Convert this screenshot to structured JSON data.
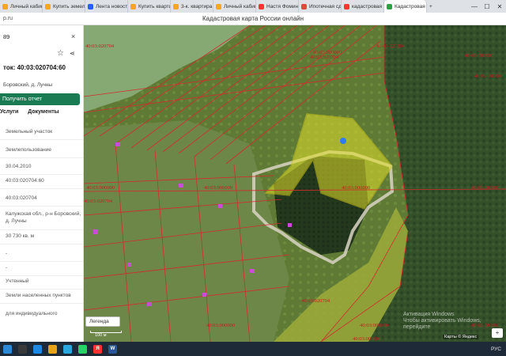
{
  "browser": {
    "tabs": [
      {
        "label": "Личный кабин",
        "color": "#f5a623"
      },
      {
        "label": "Купить земел",
        "color": "#f5a623"
      },
      {
        "label": "Лента новост",
        "color": "#2a5cff"
      },
      {
        "label": "Купить кварти",
        "color": "#f5a623"
      },
      {
        "label": "3-к. квартира,",
        "color": "#f5a623"
      },
      {
        "label": "Личный кабин",
        "color": "#f5a623"
      },
      {
        "label": "Настя Фомина",
        "color": "#ff3333"
      },
      {
        "label": "Ипотечная сд",
        "color": "#e0493a"
      },
      {
        "label": "кадастровая ка",
        "color": "#ff3333"
      },
      {
        "label": "Кадастровая",
        "color": "#2ea043"
      }
    ],
    "close_glyph": "×",
    "new_tab_glyph": "+",
    "url_fragment": "p.ru",
    "page_title": "Кадастровая карта России онлайн",
    "window_controls": {
      "minimize": "—",
      "maximize": "☐",
      "close": "✕"
    }
  },
  "sidebar": {
    "id_fragment": "89",
    "close_glyph": "×",
    "star_glyph": "☆",
    "share_glyph": "⋖",
    "title": "ток: 40:03:020704:60",
    "address_short": "Боровский, д. Лучны",
    "report_button": "Получить отчет",
    "tabs": [
      "Услуги",
      "Документы"
    ],
    "fields": [
      "Земельный участок",
      "Землепользование",
      "30.04.2010",
      "40:03:020704:60",
      "40:03:020704",
      "Калужская обл., р-н Боровский, д. Лучны",
      "30 730 кв. м",
      "-",
      "-",
      "Учтенный",
      "Земли населенных пунктов",
      "для индивидуального"
    ]
  },
  "map": {
    "labels": [
      "40:03:020704",
      "40:03:000000",
      "40:03:020704",
      "40:03:020804",
      "40:03:000000",
      "40:03:000000",
      "40:03:000000",
      "40:03:000000",
      "40:03:000000",
      "40:03:020704",
      "40:03:020704",
      "40:03:000000",
      "40:03:000000",
      "40:03:000000",
      "40:03:000000",
      "40:03:000000"
    ],
    "legend_label": "Легенда",
    "scale_label": "100 м",
    "attribution": "Карты © Яндекс",
    "watermark": [
      "Активация Windows",
      "Чтобы активировать Windows, перейдите"
    ],
    "zoom_glyph": "+",
    "colors": {
      "boundary": "#d42b2b",
      "selected_fill": "#e2e02a",
      "forest": "#2f4a26",
      "field": "#7d9a3f",
      "lake": "#8fae7a"
    }
  },
  "taskbar": {
    "tray_lang": "РУС",
    "word_label": "W",
    "yandex_label": "Я"
  }
}
